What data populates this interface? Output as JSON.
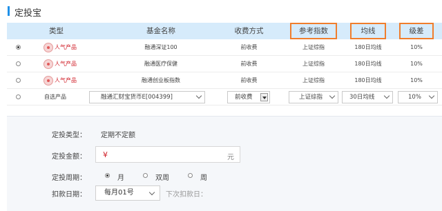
{
  "section": {
    "title": "定投宝"
  },
  "table": {
    "headers": {
      "type": "类型",
      "fund_name": "基金名称",
      "fee": "收费方式",
      "index": "参考指数",
      "ma": "均线",
      "diff": "级差"
    },
    "highlight_color": "#f07d2c",
    "rows": [
      {
        "selected": true,
        "type": "人气产品",
        "fund": "融通深证100",
        "fee": "前收费",
        "index": "上证综指",
        "ma": "180日均线",
        "diff": "10%"
      },
      {
        "selected": false,
        "type": "人气产品",
        "fund": "融通医疗保健",
        "fee": "前收费",
        "index": "上证综指",
        "ma": "180日均线",
        "diff": "10%"
      },
      {
        "selected": false,
        "type": "人气产品",
        "fund": "融通创业板指数",
        "fee": "前收费",
        "index": "上证综指",
        "ma": "180日均线",
        "diff": "10%"
      }
    ],
    "custom_row": {
      "selected": false,
      "type": "自选产品",
      "fund": "融通汇财宝货币E[004399]",
      "fee": "前收费",
      "index": "上证综指",
      "ma": "30日均线",
      "diff": "10%"
    }
  },
  "form": {
    "plan_type_label": "定投类型：",
    "plan_type_value": "定期不定额",
    "amount_label": "定投金额：",
    "currency_symbol": "¥",
    "amount_value": "",
    "amount_unit": "元",
    "period_label": "定投周期：",
    "period_options": [
      "月",
      "双周",
      "周"
    ],
    "period_selected": "月",
    "debit_label": "扣款日期：",
    "debit_value": "每月01号",
    "next_debit_label": "下次扣款日："
  }
}
